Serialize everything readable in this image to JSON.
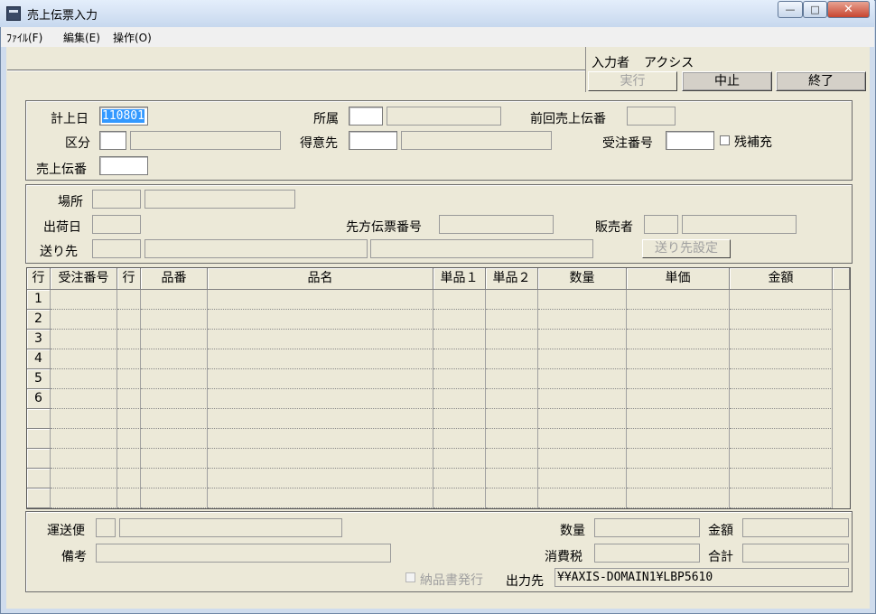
{
  "window": {
    "title": "売上伝票入力",
    "minimize": "—",
    "maximize": "□",
    "close": "✕"
  },
  "menu": [
    "ﾌｧｲﾙ(F)",
    "編集(E)",
    "操作(O)"
  ],
  "header": {
    "operator_label": "入力者",
    "operator_name": "アクシス",
    "buttons": {
      "execute": "実行",
      "cancel": "中止",
      "exit": "終了"
    }
  },
  "section1": {
    "posting_date_label": "計上日",
    "posting_date_value": "110801",
    "category_label": "区分",
    "sales_slip_label": "売上伝番",
    "department_label": "所属",
    "customer_label": "得意先",
    "prev_slip_label": "前回売上伝番",
    "order_no_label": "受注番号",
    "remaining_label": "残補充"
  },
  "section2": {
    "location_label": "場所",
    "ship_date_label": "出荷日",
    "ship_to_label": "送り先",
    "partner_slip_label": "先方伝票番号",
    "seller_label": "販売者",
    "ship_to_button": "送り先設定"
  },
  "grid": {
    "columns": [
      "行",
      "受注番号",
      "行",
      "品番",
      "品名",
      "単品１",
      "単品２",
      "数量",
      "単価",
      "金額"
    ],
    "row_numbers": [
      "1",
      "2",
      "3",
      "4",
      "5",
      "6",
      "",
      "",
      "",
      "",
      ""
    ]
  },
  "footer": {
    "carrier_label": "運送便",
    "remarks_label": "備考",
    "quantity_label": "数量",
    "amount_label": "金額",
    "tax_label": "消費税",
    "total_label": "合計",
    "delivery_note_label": "納品書発行",
    "output_label": "出力先",
    "output_value": "¥¥AXIS-DOMAIN1¥LBP5610"
  }
}
